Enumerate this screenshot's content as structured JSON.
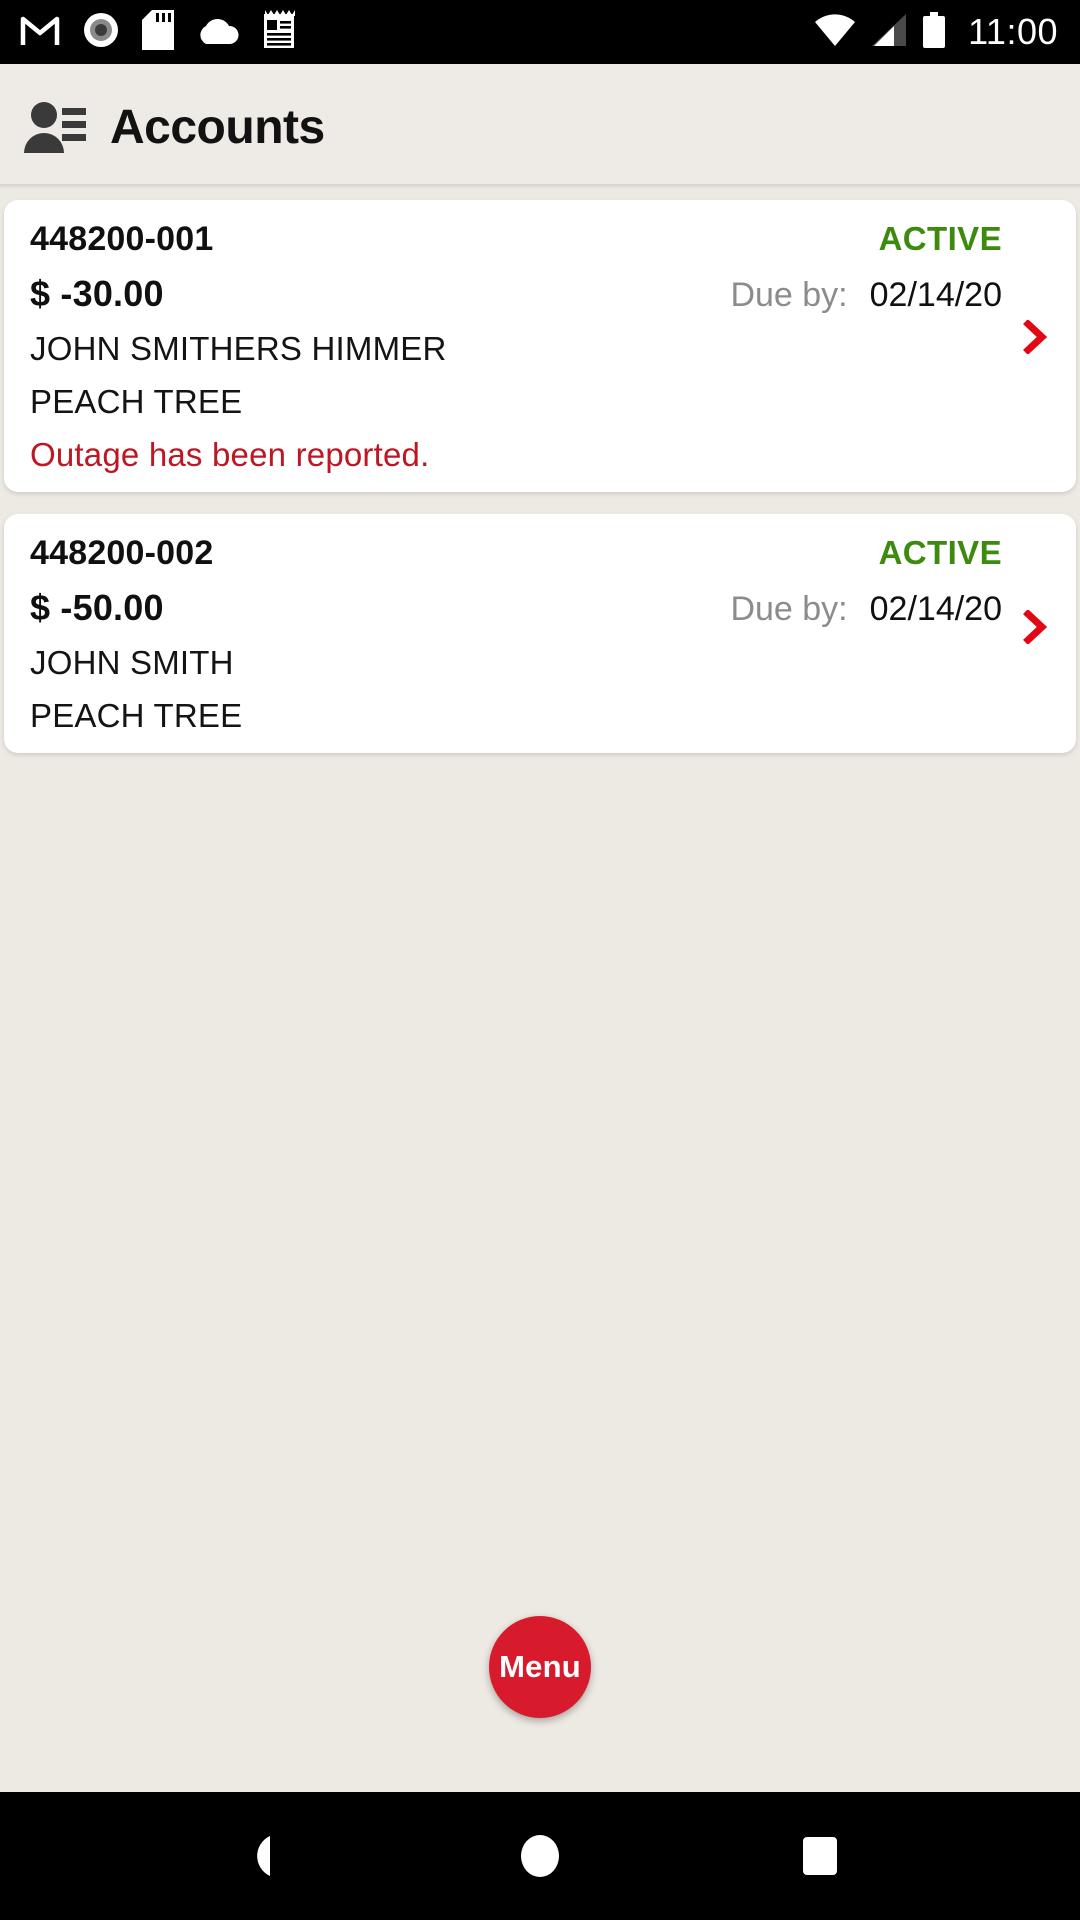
{
  "statusbar": {
    "left_icons": [
      "gmail-icon",
      "screen-record-icon",
      "sd-card-icon",
      "cloud-icon",
      "notepad-icon"
    ],
    "right_icons": [
      "wifi-icon",
      "cellular-signal-icon",
      "battery-icon"
    ],
    "time": "11:00"
  },
  "appbar": {
    "icon": "contact-page-icon",
    "title": "Accounts"
  },
  "accounts": [
    {
      "number": "448200-001",
      "status": "ACTIVE",
      "amount": "$ -30.00",
      "due_label": "Due by:",
      "due_date": "02/14/20",
      "customer": "JOHN SMITHERS HIMMER",
      "location": "PEACH TREE",
      "alert": "Outage has been reported.",
      "chevron": "chevron-right-icon"
    },
    {
      "number": "448200-002",
      "status": "ACTIVE",
      "amount": "$ -50.00",
      "due_label": "Due by:",
      "due_date": "02/14/20",
      "customer": "JOHN SMITH",
      "location": "PEACH TREE",
      "alert": "",
      "chevron": "chevron-right-icon"
    }
  ],
  "fab": {
    "label": "Menu",
    "color": "#D81B2C"
  },
  "navbar": {
    "back": "back-triangle-icon",
    "home": "home-circle-icon",
    "recents": "recents-square-icon"
  },
  "colors": {
    "background": "#EDE9E3",
    "card": "#FFFFFF",
    "status_active": "#3C8A0E",
    "alert_red": "#BE1622",
    "chevron_red": "#E30613",
    "due_label_gray": "#8C8C8C"
  }
}
